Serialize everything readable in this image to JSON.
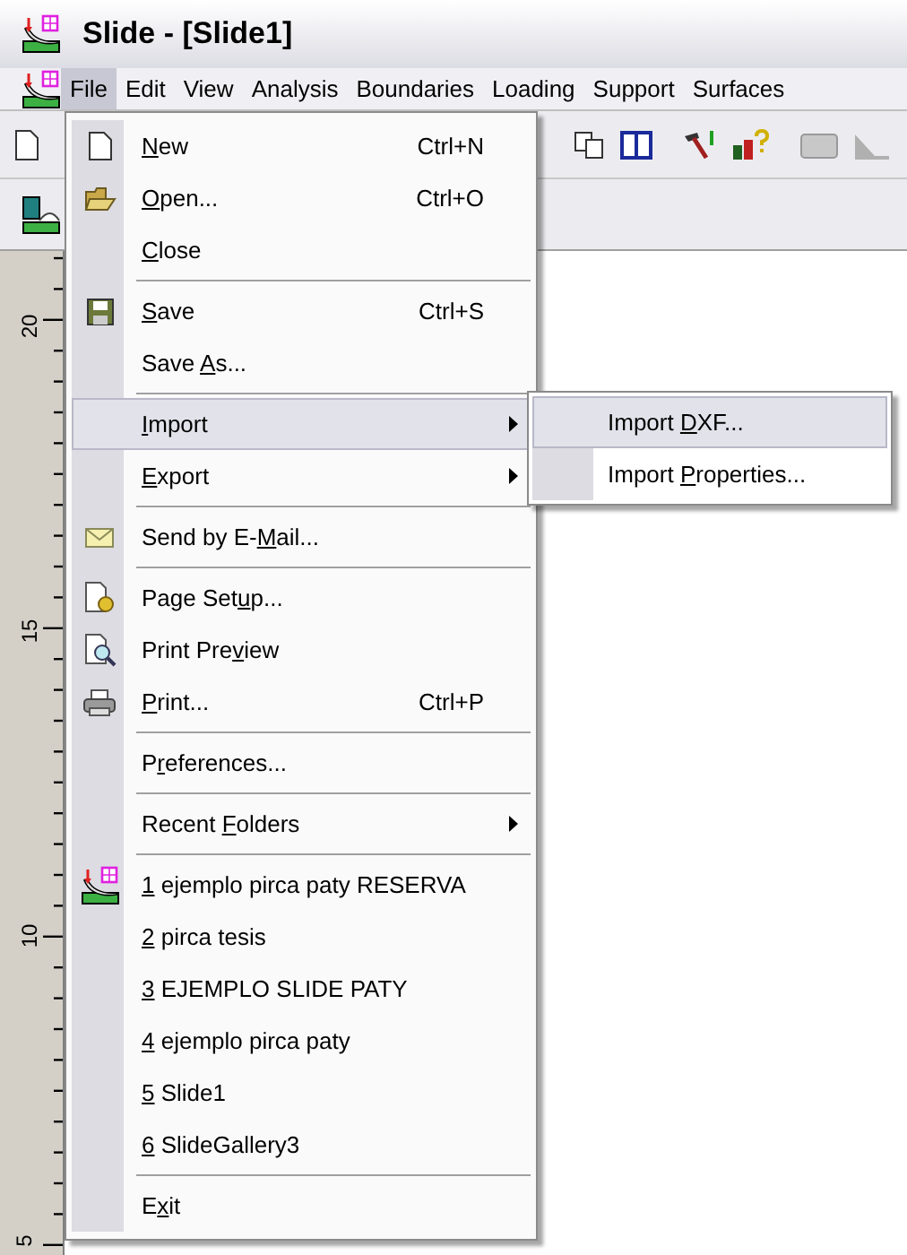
{
  "window": {
    "title": "Slide - [Slide1]"
  },
  "menu_bar": [
    {
      "label": "File",
      "selected": true
    },
    {
      "label": "Edit",
      "selected": false
    },
    {
      "label": "View",
      "selected": false
    },
    {
      "label": "Analysis",
      "selected": false
    },
    {
      "label": "Boundaries",
      "selected": false
    },
    {
      "label": "Loading",
      "selected": false
    },
    {
      "label": "Support",
      "selected": false
    },
    {
      "label": "Surfaces",
      "selected": false
    }
  ],
  "ruler_labels": [
    "20",
    "15",
    "10",
    "5"
  ],
  "file_menu": [
    {
      "kind": "item",
      "mnemonic": "N",
      "after": "ew",
      "shortcut": "Ctrl+N",
      "selected": false
    },
    {
      "kind": "item",
      "mnemonic": "O",
      "after": "pen...",
      "shortcut": "Ctrl+O",
      "selected": false
    },
    {
      "kind": "item",
      "mnemonic": "C",
      "after": "lose",
      "selected": false
    },
    {
      "kind": "separator"
    },
    {
      "kind": "item",
      "mnemonic": "S",
      "after": "ave",
      "shortcut": "Ctrl+S",
      "selected": false
    },
    {
      "kind": "item",
      "before": "Save ",
      "mnemonic": "A",
      "after": "s...",
      "selected": false
    },
    {
      "kind": "separator"
    },
    {
      "kind": "submenu",
      "mnemonic": "I",
      "after": "mport",
      "selected": true
    },
    {
      "kind": "submenu",
      "mnemonic": "E",
      "after": "xport",
      "selected": false
    },
    {
      "kind": "separator"
    },
    {
      "kind": "item",
      "before": "Send by E-",
      "mnemonic": "M",
      "after": "ail...",
      "selected": false
    },
    {
      "kind": "separator"
    },
    {
      "kind": "item",
      "before": "Page Set",
      "mnemonic": "u",
      "after": "p...",
      "selected": false
    },
    {
      "kind": "item",
      "before": "Print Pre",
      "mnemonic": "v",
      "after": "iew",
      "selected": false
    },
    {
      "kind": "item",
      "mnemonic": "P",
      "after": "rint...",
      "shortcut": "Ctrl+P",
      "selected": false
    },
    {
      "kind": "separator"
    },
    {
      "kind": "item",
      "before": "P",
      "mnemonic": "r",
      "after": "eferences...",
      "selected": false
    },
    {
      "kind": "separator"
    },
    {
      "kind": "submenu",
      "before": "Recent ",
      "mnemonic": "F",
      "after": "olders",
      "selected": false
    },
    {
      "kind": "separator"
    },
    {
      "kind": "item",
      "mnemonic": "1",
      "after": " ejemplo pirca paty RESERVA",
      "selected": false
    },
    {
      "kind": "item",
      "mnemonic": "2",
      "after": " pirca tesis",
      "selected": false
    },
    {
      "kind": "item",
      "mnemonic": "3",
      "after": " EJEMPLO SLIDE PATY",
      "selected": false
    },
    {
      "kind": "item",
      "mnemonic": "4",
      "after": " ejemplo pirca paty",
      "selected": false
    },
    {
      "kind": "item",
      "mnemonic": "5",
      "after": " Slide1",
      "selected": false
    },
    {
      "kind": "item",
      "mnemonic": "6",
      "after": " SlideGallery3",
      "selected": false
    },
    {
      "kind": "separator"
    },
    {
      "kind": "item",
      "before": "E",
      "mnemonic": "x",
      "after": "it",
      "selected": false
    }
  ],
  "import_submenu": [
    {
      "before": "Import ",
      "mnemonic": "D",
      "after": "XF...",
      "selected": true
    },
    {
      "before": "Import ",
      "mnemonic": "P",
      "after": "roperties...",
      "selected": false
    }
  ]
}
